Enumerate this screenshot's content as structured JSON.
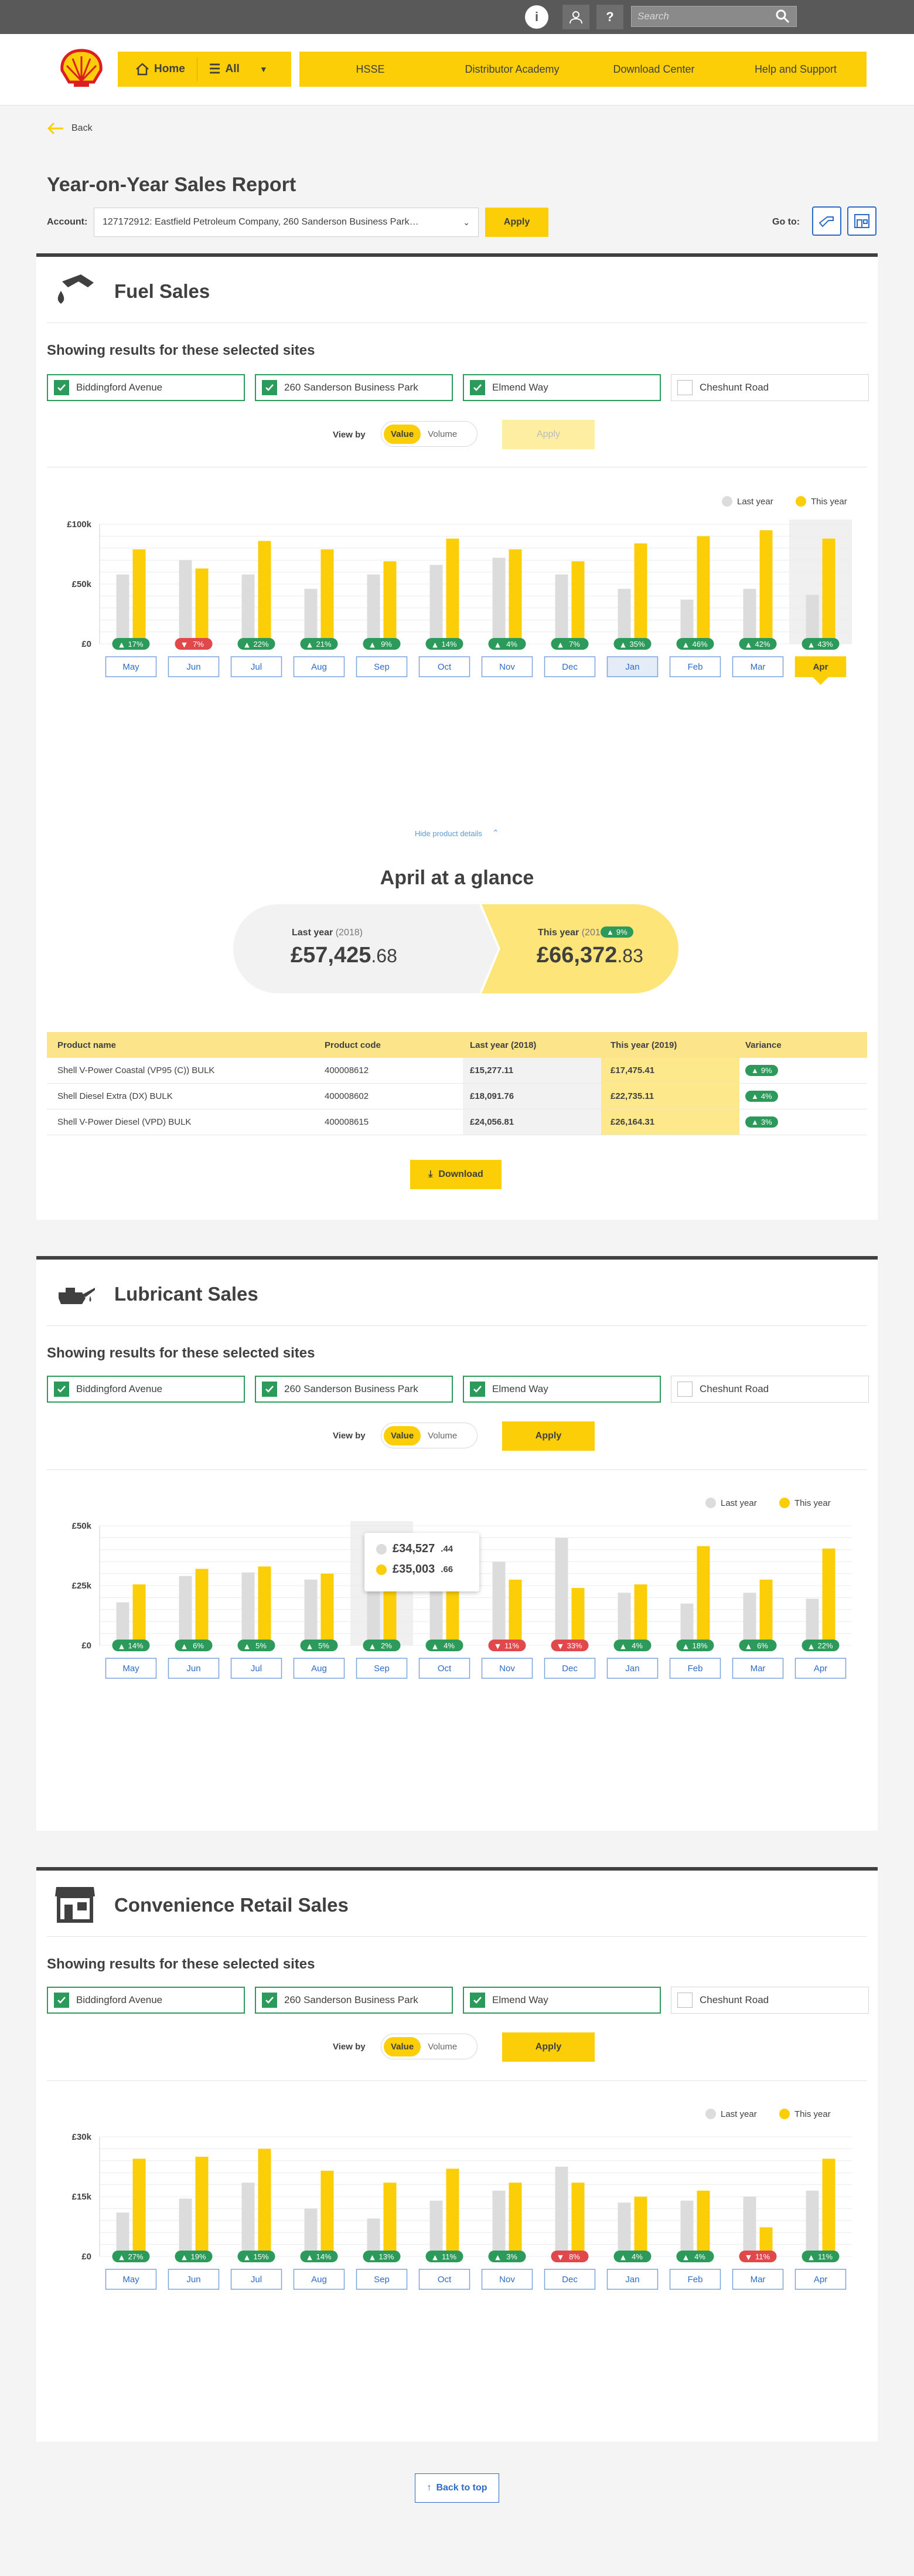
{
  "search": {
    "placeholder": "Search"
  },
  "nav": {
    "home": "Home",
    "all": "All",
    "items": [
      "HSSE",
      "Distributor Academy",
      "Download Center",
      "Help and Support"
    ]
  },
  "back": "Back",
  "page_title": "Year-on-Year Sales Report",
  "account": {
    "label": "Account:",
    "value": "127172912: Eastfield Petroleum Company, 260 Sanderson Business Park…",
    "apply": "Apply"
  },
  "goto": "Go to:",
  "sections": [
    {
      "title": "Fuel Sales",
      "subtitle": "Showing results for these selected sites",
      "viewby": "View by",
      "value": "Value",
      "volume": "Volume",
      "apply": "Apply"
    },
    {
      "title": "Lubricant Sales",
      "subtitle": "Showing results for these selected sites",
      "viewby": "View by",
      "value": "Value",
      "volume": "Volume",
      "apply": "Apply"
    },
    {
      "title": "Convenience Retail Sales",
      "subtitle": "Showing results for these selected sites",
      "viewby": "View by",
      "value": "Value",
      "volume": "Volume",
      "apply": "Apply"
    }
  ],
  "sites": [
    {
      "name": "Biddingford Avenue",
      "checked": true
    },
    {
      "name": "260 Sanderson Business Park",
      "checked": true
    },
    {
      "name": "Elmend Way",
      "checked": true
    },
    {
      "name": "Cheshunt Road",
      "checked": false
    }
  ],
  "legend": {
    "last": "Last year",
    "this": "This year"
  },
  "colors": {
    "yellow": "#fbce07",
    "grey": "#dcdcdc",
    "green": "#2c9a5a",
    "red": "#e0484c",
    "blue": "#2e6bc6"
  },
  "hide_details": "Hide product details",
  "glance": {
    "title": "April at a glance",
    "last_label": "Last year",
    "last_year": "(2018)",
    "last_value": "£57,425",
    "last_pence": ".68",
    "this_label": "This year",
    "this_year": "(2019)",
    "this_value": "£66,372",
    "this_pence": ".83",
    "change": "9%"
  },
  "table": {
    "headers": [
      "Product name",
      "Product code",
      "Last year (2018)",
      "This year (2019)",
      "Variance"
    ],
    "rows": [
      {
        "name": "Shell V-Power Coastal (VP95 (C)) BULK",
        "code": "400008612",
        "last": "£15,277.11",
        "this": "£17,475.41",
        "var": "9%"
      },
      {
        "name": "Shell Diesel Extra (DX) BULK",
        "code": "400008602",
        "last": "£18,091.76",
        "this": "£22,735.11",
        "var": "4%"
      },
      {
        "name": "Shell V-Power Diesel (VPD) BULK",
        "code": "400008615",
        "last": "£24,056.81",
        "this": "£26,164.31",
        "var": "3%"
      }
    ]
  },
  "download": "Download",
  "tooltip": {
    "last": "£34,527",
    "last_p": ".44",
    "this": "£35,003",
    "this_p": ".66"
  },
  "back_top": "Back to top",
  "chart_data": [
    {
      "type": "bar",
      "title": "Fuel Sales",
      "categories": [
        "May",
        "Jun",
        "Jul",
        "Aug",
        "Sep",
        "Oct",
        "Nov",
        "Dec",
        "Jan",
        "Feb",
        "Mar",
        "Apr"
      ],
      "yticks": [
        "£0",
        "£50k",
        "£100k"
      ],
      "ylim": [
        0,
        100000
      ],
      "series": [
        {
          "name": "Last year",
          "values": [
            58000,
            70000,
            58000,
            46000,
            58000,
            66000,
            72000,
            58000,
            46000,
            37000,
            46000,
            41000
          ]
        },
        {
          "name": "This year",
          "values": [
            79000,
            63000,
            86000,
            79000,
            69000,
            88000,
            79000,
            69000,
            84000,
            90000,
            95000,
            88000
          ]
        }
      ],
      "badges": [
        "17%",
        "7%",
        "22%",
        "21%",
        "9%",
        "14%",
        "4%",
        "7%",
        "35%",
        "46%",
        "42%",
        "43%"
      ],
      "badge_up": [
        true,
        false,
        true,
        true,
        true,
        true,
        true,
        true,
        true,
        true,
        true,
        true
      ],
      "selected": "Apr"
    },
    {
      "type": "bar",
      "title": "Lubricant Sales",
      "categories": [
        "May",
        "Jun",
        "Jul",
        "Aug",
        "Sep",
        "Oct",
        "Nov",
        "Dec",
        "Jan",
        "Feb",
        "Mar",
        "Apr"
      ],
      "yticks": [
        "£0",
        "£25k",
        "£50k"
      ],
      "ylim": [
        0,
        50000
      ],
      "series": [
        {
          "name": "Last year",
          "values": [
            18000,
            29000,
            30500,
            27500,
            31000,
            31500,
            35000,
            45000,
            22000,
            17500,
            22000,
            19500
          ]
        },
        {
          "name": "This year",
          "values": [
            25500,
            32000,
            33000,
            30000,
            32000,
            34000,
            27500,
            24000,
            25500,
            41500,
            27500,
            40500
          ]
        }
      ],
      "badges": [
        "14%",
        "6%",
        "5%",
        "5%",
        "2%",
        "4%",
        "11%",
        "33%",
        "4%",
        "18%",
        "6%",
        "22%"
      ],
      "badge_up": [
        true,
        true,
        true,
        true,
        true,
        true,
        false,
        false,
        true,
        true,
        true,
        true
      ]
    },
    {
      "type": "bar",
      "title": "Convenience Retail Sales",
      "categories": [
        "May",
        "Jun",
        "Jul",
        "Aug",
        "Sep",
        "Oct",
        "Nov",
        "Dec",
        "Jan",
        "Feb",
        "Mar",
        "Apr"
      ],
      "yticks": [
        "£0",
        "£15k",
        "£30k"
      ],
      "ylim": [
        0,
        30000
      ],
      "series": [
        {
          "name": "Last year",
          "values": [
            11000,
            14500,
            18500,
            12000,
            9500,
            14000,
            16500,
            22500,
            13500,
            14000,
            15000,
            16500
          ]
        },
        {
          "name": "This year",
          "values": [
            24500,
            25000,
            27000,
            21500,
            18500,
            22000,
            18500,
            18500,
            15000,
            16500,
            7300,
            24500
          ]
        }
      ],
      "badges": [
        "27%",
        "19%",
        "15%",
        "14%",
        "13%",
        "11%",
        "3%",
        "8%",
        "4%",
        "4%",
        "11%",
        "11%"
      ],
      "badge_up": [
        true,
        true,
        true,
        true,
        true,
        true,
        true,
        false,
        true,
        true,
        false,
        true
      ]
    }
  ]
}
